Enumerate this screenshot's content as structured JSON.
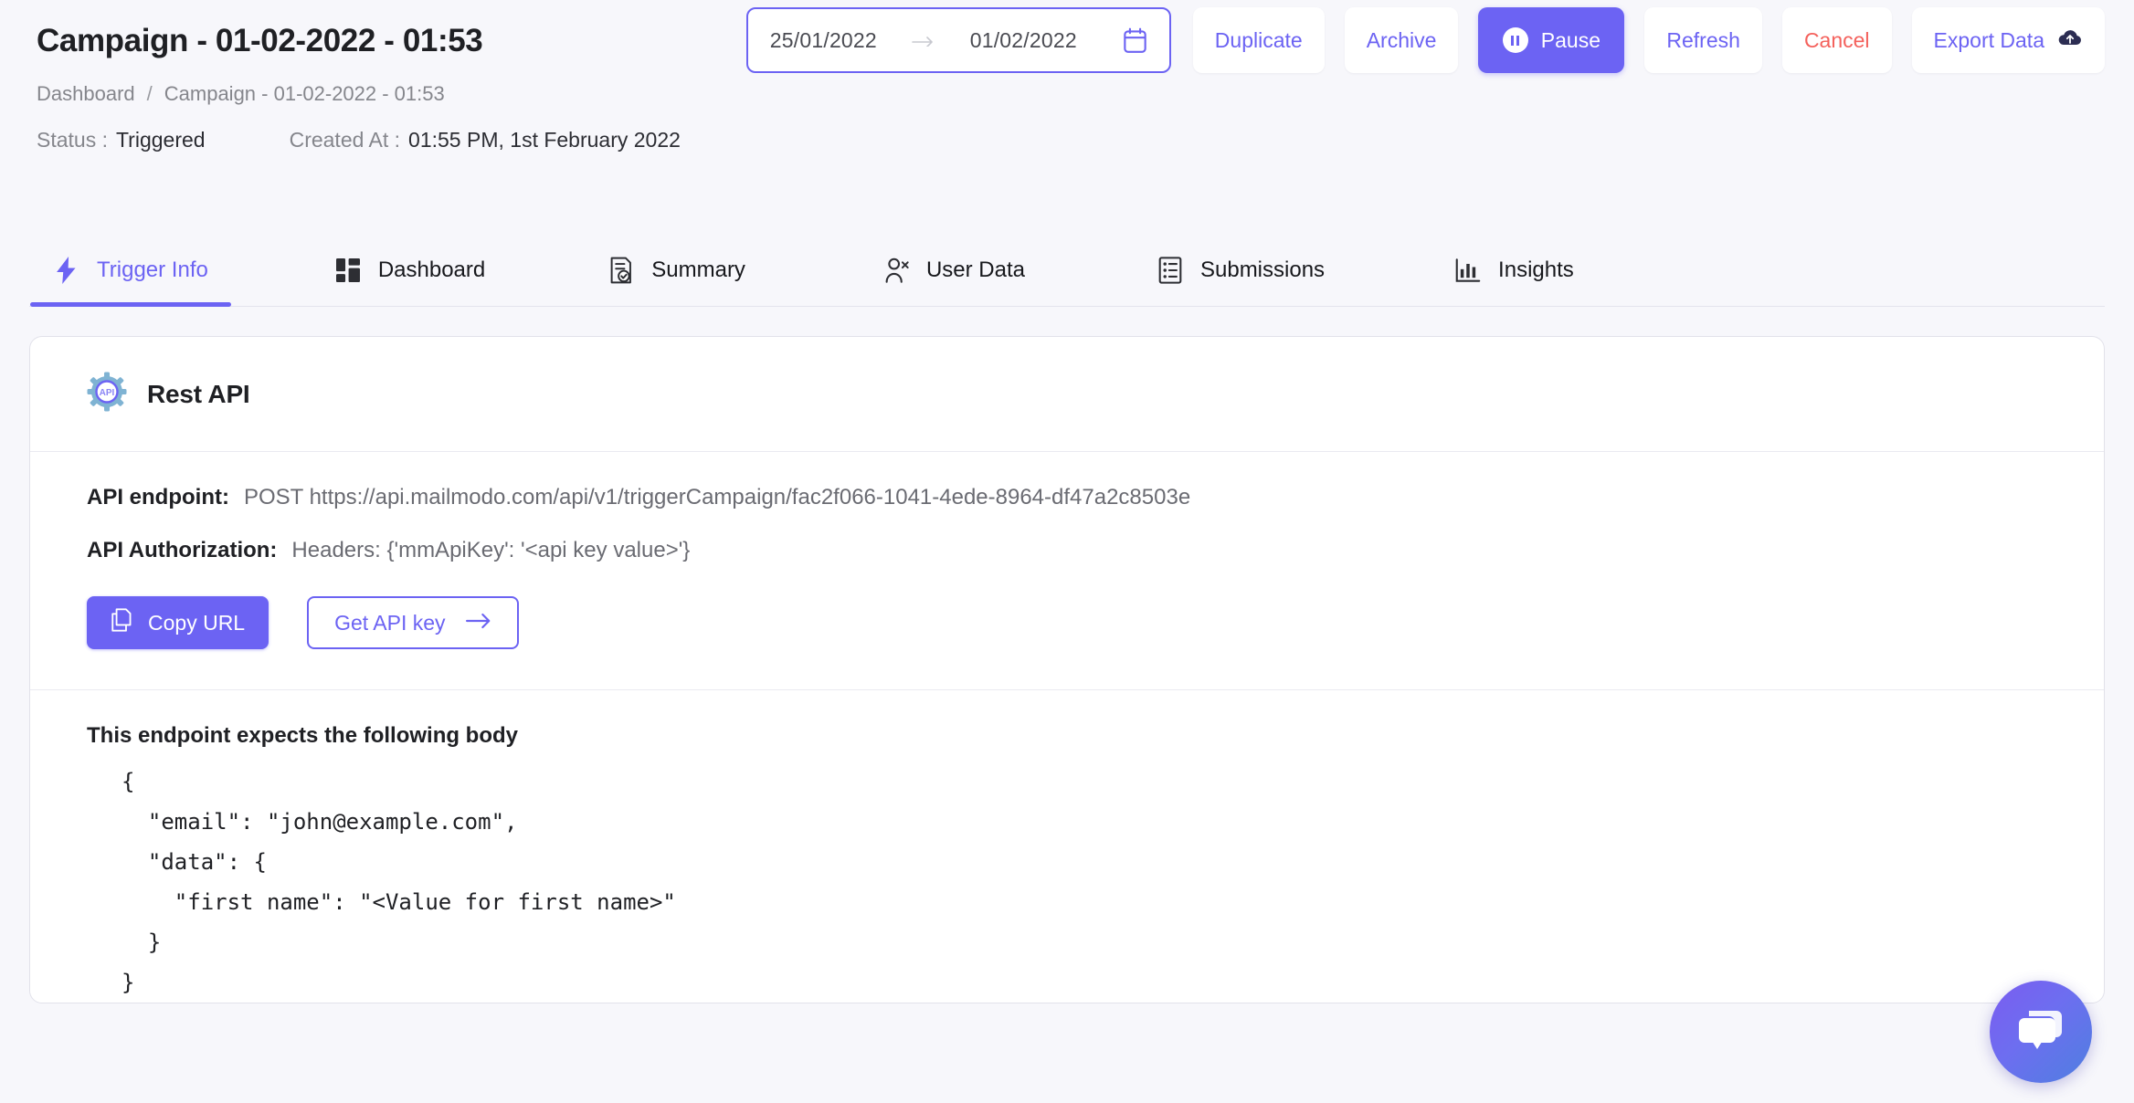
{
  "header": {
    "title": "Campaign - 01-02-2022 - 01:53",
    "breadcrumb": {
      "root": "Dashboard",
      "separator": "/",
      "current": "Campaign - 01-02-2022 - 01:53"
    },
    "status_label": "Status :",
    "status_value": "Triggered",
    "created_label": "Created At :",
    "created_value": "01:55 PM, 1st February 2022"
  },
  "toolbar": {
    "date_range": {
      "start": "25/01/2022",
      "arrow": "→",
      "end": "01/02/2022",
      "calendar_icon": "calendar-icon"
    },
    "duplicate_label": "Duplicate",
    "archive_label": "Archive",
    "pause_label": "Pause",
    "refresh_label": "Refresh",
    "cancel_label": "Cancel",
    "export_label": "Export Data"
  },
  "tabs": [
    {
      "label": "Trigger Info",
      "icon": "bolt-icon",
      "active": true
    },
    {
      "label": "Dashboard",
      "icon": "grid-icon",
      "active": false
    },
    {
      "label": "Summary",
      "icon": "document-check-icon",
      "active": false
    },
    {
      "label": "User Data",
      "icon": "user-icon",
      "active": false
    },
    {
      "label": "Submissions",
      "icon": "list-icon",
      "active": false
    },
    {
      "label": "Insights",
      "icon": "bar-chart-icon",
      "active": false
    }
  ],
  "card": {
    "title": "Rest API",
    "icon": "api-gear-icon",
    "endpoint_label": "API endpoint:",
    "endpoint_value": "POST https://api.mailmodo.com/api/v1/triggerCampaign/fac2f066-1041-4ede-8964-df47a2c8503e",
    "authorization_label": "API Authorization:",
    "authorization_value": "Headers: {'mmApiKey': '<api key value>'}",
    "copy_url_label": "Copy URL",
    "get_api_key_label": "Get API key",
    "body_title": "This endpoint expects the following body",
    "body_code": "{\n  \"email\": \"john@example.com\",\n  \"data\": {\n    \"first name\": \"<Value for first name>\"\n  }\n}"
  },
  "chat": {
    "icon": "chat-bubble-icon"
  },
  "colors": {
    "accent": "#6c63f3",
    "danger": "#f4615c",
    "page_bg": "#f7f7fb",
    "card_bg": "#ffffff",
    "text_primary": "#1f2024",
    "text_muted": "#85868c"
  }
}
